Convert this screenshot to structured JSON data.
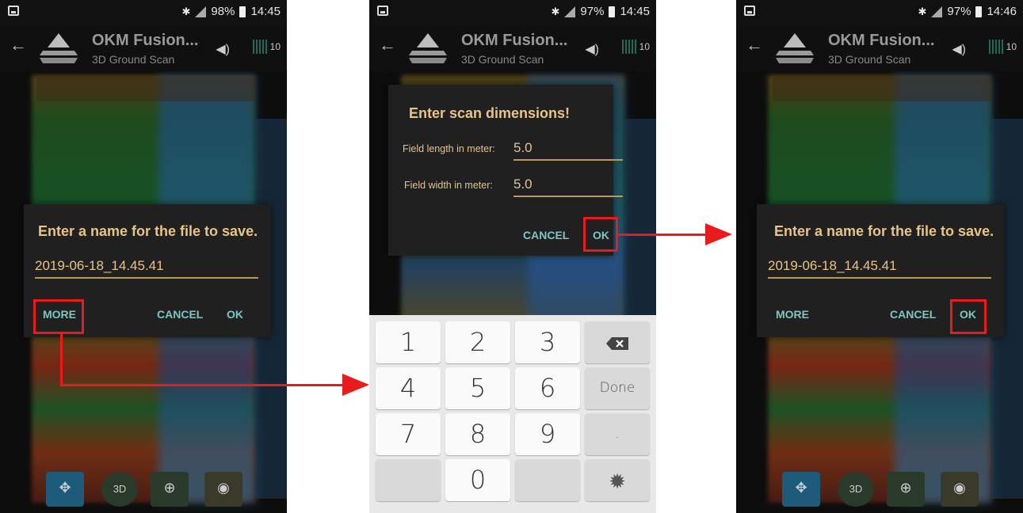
{
  "screens": [
    {
      "status": {
        "battery": "98%",
        "time": "14:45"
      },
      "app": {
        "title": "OKM Fusion...",
        "subtitle": "3D Ground Scan",
        "grid_count": "10"
      },
      "dialog": {
        "title": "Enter a name for the file to save.",
        "filename": "2019-06-18_14.45.41",
        "more": "MORE",
        "cancel": "CANCEL",
        "ok": "OK"
      }
    },
    {
      "status": {
        "battery": "97%",
        "time": "14:45"
      },
      "app": {
        "title": "OKM Fusion...",
        "subtitle": "3D Ground Scan",
        "grid_count": "10"
      },
      "dialog": {
        "title": "Enter scan dimensions!",
        "length_label": "Field length in meter:",
        "length_value": "5.0",
        "width_label": "Field width in meter:",
        "width_value": "5.0",
        "cancel": "CANCEL",
        "ok": "OK"
      },
      "keyboard": {
        "keys": [
          "1",
          "2",
          "3",
          "",
          "4",
          "5",
          "6",
          "Done",
          "7",
          "8",
          "9",
          ".",
          "",
          "0",
          "",
          ""
        ]
      }
    },
    {
      "status": {
        "battery": "97%",
        "time": "14:46"
      },
      "app": {
        "title": "OKM Fusion...",
        "subtitle": "3D Ground Scan",
        "grid_count": "10"
      },
      "dialog": {
        "title": "Enter a name for the file to save.",
        "filename": "2019-06-18_14.45.41",
        "more": "MORE",
        "cancel": "CANCEL",
        "ok": "OK"
      }
    }
  ],
  "icons": {
    "back": "arrow-left-icon",
    "speaker": "speaker-icon",
    "backspace": "backspace-icon",
    "settings": "gear-icon"
  },
  "colors": {
    "highlight": "#e81c1c",
    "dialog_text": "#e7c488",
    "button_text": "#7cc6c6"
  }
}
